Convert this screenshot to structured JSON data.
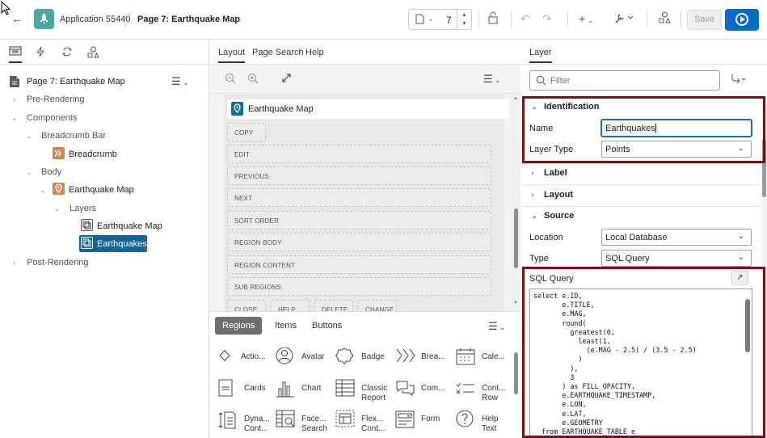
{
  "header": {
    "app_name": "Application 55440",
    "page_name": "Page 7: Earthquake Map",
    "page_number": "7",
    "save_label": "Save",
    "icons": [
      "back-arrow-icon",
      "app-rocket-icon",
      "page-doc-icon",
      "lock-icon",
      "undo-icon",
      "redo-icon",
      "create-icon",
      "utilities-wrench-icon",
      "shared-components-icon",
      "run-icon"
    ]
  },
  "left": {
    "tabs": [
      "rendering-icon",
      "dynamic-actions-icon",
      "processing-icon",
      "shared-components-icon"
    ],
    "root_label": "Page 7: Earthquake Map",
    "tree": {
      "pre_rendering": "Pre-Rendering",
      "components": "Components",
      "breadcrumb_bar": "Breadcrumb Bar",
      "breadcrumb": "Breadcrumb",
      "body": "Body",
      "earthquake_map": "Earthquake Map",
      "layers": "Layers",
      "layer_map": "Earthquake Map",
      "layer_quakes": "Earthquakes",
      "post_rendering": "Post-Rendering"
    }
  },
  "center": {
    "tabs": [
      "Layout",
      "Page Search",
      "Help"
    ],
    "region_title": "Earthquake Map",
    "slots": [
      "COPY",
      "EDIT",
      "PREVIOUS",
      "NEXT",
      "SORT ORDER",
      "REGION BODY",
      "REGION CONTENT",
      "SUB REGIONS"
    ],
    "partial_slots": [
      "CLOSE",
      "HELP",
      "DELETE",
      "CHANGE"
    ],
    "gallery_tabs": [
      "Regions",
      "Items",
      "Buttons"
    ],
    "gallery": [
      {
        "label": "Actio...",
        "icon": "diamond-icon"
      },
      {
        "label": "Avatar",
        "icon": "avatar-icon"
      },
      {
        "label": "Badge",
        "icon": "badge-icon"
      },
      {
        "label": "Brea...",
        "icon": "breadcrumb-icon"
      },
      {
        "label": "Cale...",
        "icon": "calendar-icon"
      },
      {
        "label": "Cards",
        "icon": "cards-icon"
      },
      {
        "label": "Chart",
        "icon": "chart-icon"
      },
      {
        "label": "Classic\nReport",
        "icon": "table-icon"
      },
      {
        "label": "Com...",
        "icon": "comments-icon"
      },
      {
        "label": "Cont...\nRow",
        "icon": "content-row-icon"
      },
      {
        "label": "Dyna...\nCont...",
        "icon": "dynamic-content-icon"
      },
      {
        "label": "Face...\nSearch",
        "icon": "faceted-search-icon"
      },
      {
        "label": "Flex...\nCont...",
        "icon": "flex-container-icon"
      },
      {
        "label": "Form",
        "icon": "form-icon"
      },
      {
        "label": "Help\nText",
        "icon": "help-icon"
      }
    ]
  },
  "right": {
    "tab": "Layer",
    "filter_placeholder": "Filter",
    "identification": {
      "header": "Identification",
      "name_label": "Name",
      "name_value": "Earthquakes",
      "layer_type_label": "Layer Type",
      "layer_type_value": "Points"
    },
    "label_header": "Label",
    "layout_header": "Layout",
    "source": {
      "header": "Source",
      "location_label": "Location",
      "location_value": "Local Database",
      "type_label": "Type",
      "type_value": "SQL Query",
      "sql_label": "SQL Query",
      "sql": "select e.ID,\n       e.TITLE,\n       e.MAG,\n       round(\n         greatest(0,\n           least(1,\n             (e.MAG - 2.5) / (3.5 - 2.5)\n           )\n         ),\n         3\n       ) as FILL_OPACITY,\n       e.EARTHQUAKE_TIMESTAMP,\n       e.LON,\n       e.LAT,\n       e.GEOMETRY\n  from EARTHQUAKE_TABLE e"
    },
    "highlight_color": "#7b1113"
  }
}
